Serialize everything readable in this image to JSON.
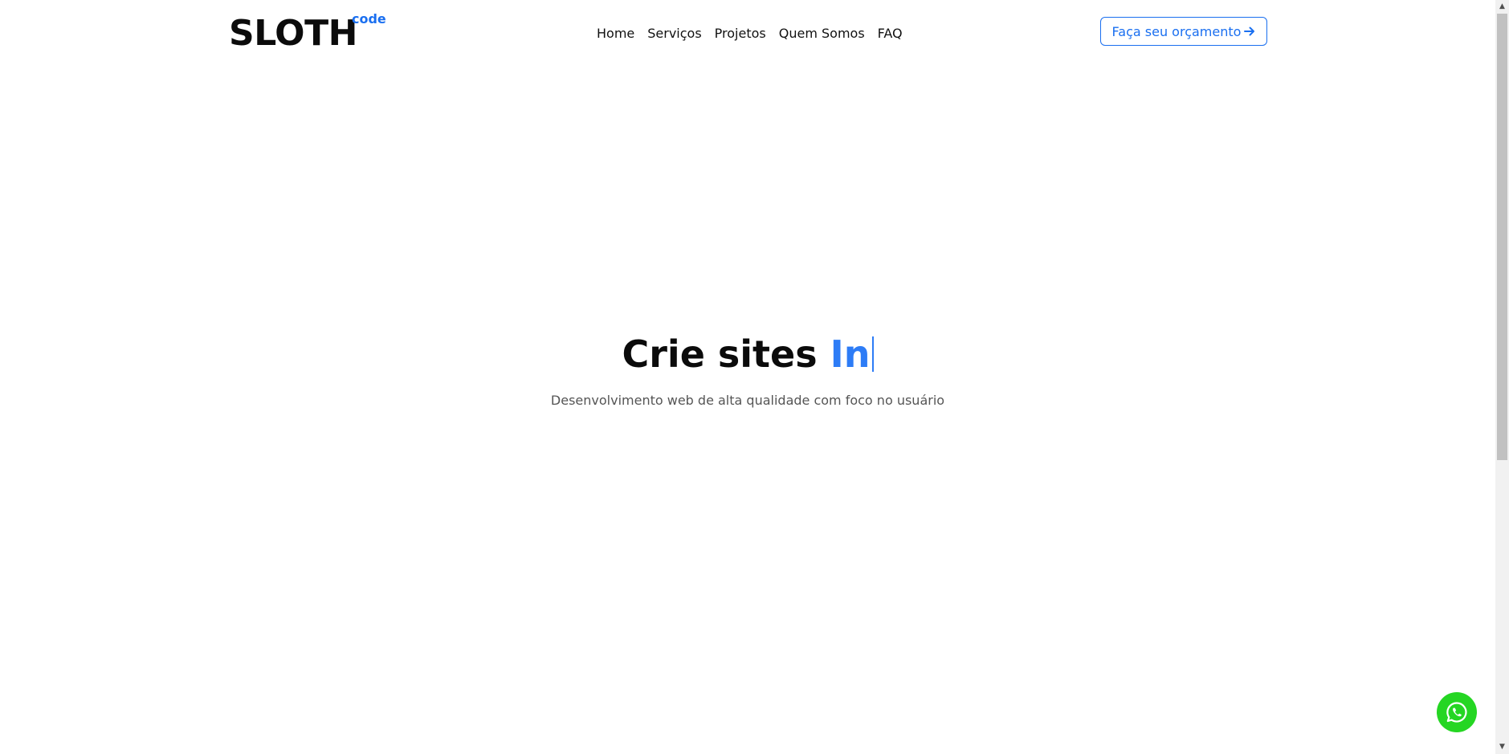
{
  "header": {
    "logo_text": "SLOTH",
    "logo_superscript": "code",
    "nav": [
      {
        "label": "Home"
      },
      {
        "label": "Serviços"
      },
      {
        "label": "Projetos"
      },
      {
        "label": "Quem Somos"
      },
      {
        "label": "FAQ"
      }
    ],
    "cta_label": "Faça seu orçamento",
    "cta_icon": "arrow-right-icon"
  },
  "hero": {
    "title_static": "Crie sites ",
    "title_typed": "In",
    "subtitle": "Desenvolvimento web de alta qualidade com foco no usuário"
  },
  "floating": {
    "whatsapp_icon": "whatsapp-icon"
  },
  "colors": {
    "accent": "#1a6ff0",
    "typed_text": "#2d7cf6",
    "whatsapp": "#25d623",
    "text": "#0b0b0b",
    "muted": "#555555"
  }
}
